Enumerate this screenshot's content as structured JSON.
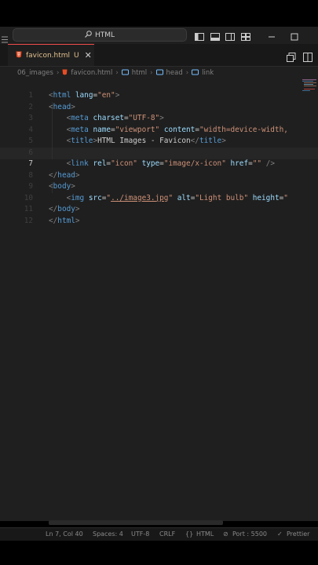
{
  "titlebar": {
    "search": "HTML"
  },
  "tab": {
    "filename": "favicon.html",
    "status": "U"
  },
  "breadcrumbs": [
    "06_images",
    "favicon.html",
    "html",
    "head",
    "link"
  ],
  "lines": [
    {
      "n": "1",
      "html": "<span class='p'>&lt;</span><span class='t'>html</span> <span class='a'>lang</span><span class='x'>=</span><span class='s'>\"en\"</span><span class='p'>&gt;</span>"
    },
    {
      "n": "2",
      "html": "<span class='p'>&lt;</span><span class='t'>head</span><span class='p'>&gt;</span>"
    },
    {
      "n": "3",
      "html": "    <span class='p'>&lt;</span><span class='t'>meta</span> <span class='a'>charset</span><span class='x'>=</span><span class='s'>\"UTF-8\"</span><span class='p'>&gt;</span>"
    },
    {
      "n": "4",
      "html": "    <span class='p'>&lt;</span><span class='t'>meta</span> <span class='a'>name</span><span class='x'>=</span><span class='s'>\"viewport\"</span> <span class='a'>content</span><span class='x'>=</span><span class='s'>\"width=device-width,</span>"
    },
    {
      "n": "5",
      "html": "    <span class='p'>&lt;</span><span class='t'>title</span><span class='p'>&gt;</span><span class='x'>HTML Images - Favicon</span><span class='p'>&lt;/</span><span class='t'>title</span><span class='p'>&gt;</span>"
    },
    {
      "n": "6",
      "html": ""
    },
    {
      "n": "7",
      "html": "    <span class='p'>&lt;</span><span class='t'>link</span> <span class='a'>rel</span><span class='x'>=</span><span class='s'>\"icon\"</span> <span class='a'>type</span><span class='x'>=</span><span class='s'>\"image/x-icon\"</span> <span class='a'>href</span><span class='x'>=</span><span class='s'>\"\"</span> <span class='p'>/&gt;</span>"
    },
    {
      "n": "8",
      "html": "<span class='p'>&lt;/</span><span class='t'>head</span><span class='p'>&gt;</span>"
    },
    {
      "n": "9",
      "html": "<span class='p'>&lt;</span><span class='t'>body</span><span class='p'>&gt;</span>"
    },
    {
      "n": "10",
      "html": "    <span class='p'>&lt;</span><span class='t'>img</span> <span class='a'>src</span><span class='x'>=</span><span class='s'>\"<u>../image3.jpg</u>\"</span> <span class='a'>alt</span><span class='x'>=</span><span class='s'>\"Light bulb\"</span> <span class='a'>height</span><span class='x'>=</span><span class='s'>\"</span>"
    },
    {
      "n": "11",
      "html": "<span class='p'>&lt;/</span><span class='t'>body</span><span class='p'>&gt;</span>"
    },
    {
      "n": "12",
      "html": "<span class='p'>&lt;/</span><span class='t'>html</span><span class='p'>&gt;</span>"
    }
  ],
  "active_line": "7",
  "status": {
    "position": "Ln 7, Col 40",
    "spaces": "Spaces: 4",
    "encoding": "UTF-8",
    "eol": "CRLF",
    "language": "HTML",
    "port": "Port : 5500",
    "formatter": "Prettier"
  },
  "colors": {
    "tab_accent": "#f14c4c",
    "html_file_icon": "#e44d26",
    "modified": "#e2c08d"
  }
}
